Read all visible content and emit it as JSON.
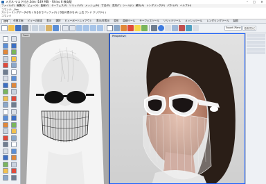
{
  "window": {
    "title": "メガネ-マスク付き.3dm (149 MB) - Rhino 6 教育版",
    "minimize": "–",
    "maximize": "□",
    "close": "✕"
  },
  "menu": [
    "ファイル(F)",
    "編集(E)",
    "ビュー(V)",
    "曲線(C)",
    "サーフェス(S)",
    "ソリッド(O)",
    "メッシュ(M)",
    "寸法(D)",
    "変形(T)",
    "ツール(L)",
    "解析(A)",
    "レンダリング(R)",
    "パネル(P)",
    "ヘルプ(H)"
  ],
  "command_history": {
    "line1": "コマンド: _Pan",
    "line2": "ストリーミングデータがなくなるまでバッファ(F) ( 次回の表示を(A) 上位 アンド クリア(U) )",
    "prompt": "コマンド"
  },
  "tabs": [
    {
      "label": "標準",
      "active": true
    },
    {
      "label": "作業平面",
      "active": false
    },
    {
      "label": "ビューの設定",
      "active": false
    },
    {
      "label": "表示",
      "active": false
    },
    {
      "label": "選択",
      "active": false
    },
    {
      "label": "ビューポートレイアウト",
      "active": false
    },
    {
      "label": "表示/非表示",
      "active": false
    },
    {
      "label": "変形",
      "active": false
    },
    {
      "label": "曲線ツール",
      "active": false
    },
    {
      "label": "サーフェスツール",
      "active": false
    },
    {
      "label": "ソリッドツール",
      "active": false
    },
    {
      "label": "メッシュツール",
      "active": false
    },
    {
      "label": "レンダリングツール",
      "active": false
    },
    {
      "label": "製図",
      "active": false
    }
  ],
  "panel_tabs": [
    "Export (Plane",
    "名前付きビ"
  ],
  "viewports": {
    "left_label": "Front",
    "right_label": "Perspective"
  },
  "colors": {
    "accent_border": "#1a60ff",
    "left_viewport_bg": "#a8a8a8"
  },
  "toolbar_icons": [
    "new-file-icon",
    "open-file-icon",
    "save-icon",
    "print-icon",
    "cut-icon",
    "copy-icon",
    "paste-icon",
    "undo-icon",
    "pan-icon",
    "rotate-view-icon",
    "zoom-icon",
    "zoom-window-icon",
    "zoom-extents-icon",
    "zoom-selected-icon",
    "viewport-4-icon",
    "shaded-icon",
    "rendered-icon",
    "material-icon",
    "light-icon",
    "render-icon",
    "options-icon",
    "help-icon"
  ],
  "left_tool_icons": [
    "select-icon",
    "point-icon",
    "polyline-icon",
    "curve-icon",
    "arc-icon",
    "circle-icon",
    "rectangle-icon",
    "ellipse-icon",
    "polygon-icon",
    "offset-icon",
    "fillet-icon",
    "extend-icon",
    "trim-icon",
    "split-icon",
    "join-icon",
    "explode-icon",
    "surface-icon",
    "extrude-icon",
    "loft-icon",
    "revolve-icon",
    "sweep-icon",
    "box-icon",
    "sphere-icon",
    "cylinder-icon",
    "cone-icon",
    "torus-icon",
    "boolean-union-icon",
    "boolean-diff-icon",
    "mesh-icon",
    "move-icon",
    "copy-obj-icon",
    "rotate-icon",
    "scale-icon",
    "mirror-icon",
    "array-icon",
    "group-icon",
    "layer-icon",
    "dimension-icon",
    "text-icon",
    "analyze-icon",
    "osnap-icon",
    "grid-icon",
    "gumball-icon",
    "history-icon"
  ]
}
